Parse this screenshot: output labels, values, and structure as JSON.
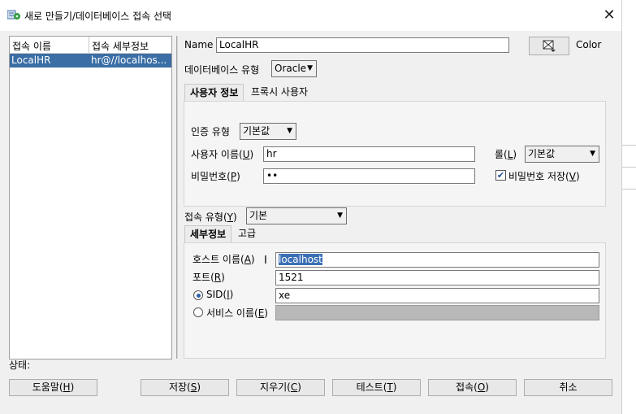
{
  "window": {
    "title": "새로 만들기/데이터베이스 접속 선택",
    "close_glyph": "✕"
  },
  "connections": {
    "columns": [
      "접속 이름",
      "접속 세부정보"
    ],
    "rows": [
      {
        "name": "LocalHR",
        "details": "hr@//localhos..."
      }
    ]
  },
  "form": {
    "name_label": "Name",
    "name_value": "LocalHR",
    "color_label": "Color",
    "dbtype_label": "데이터베이스 유형",
    "dbtype_value": "Oracle",
    "tabs": [
      "사용자 정보",
      "프록시 사용자"
    ],
    "auth_type_label": "인증 유형",
    "auth_type_value": "기본값",
    "username_label": "사용자 이름(",
    "username_key": "U",
    "username_value": "hr",
    "role_label": "롤(",
    "role_key": "L",
    "role_value": "기본값",
    "password_label": "비밀번호(",
    "password_key": "P",
    "password_value": "••",
    "save_password_label": "비밀번호 저장(",
    "save_password_key": "V",
    "save_password_checked": true,
    "conn_type_label": "접속 유형(",
    "conn_type_key": "Y",
    "conn_type_value": "기본",
    "detail_tabs": [
      "세부정보",
      "고급"
    ],
    "host_label": "호스트 이름(",
    "host_key": "A",
    "host_value": "localhost",
    "port_label": "포트(",
    "port_key": "R",
    "port_value": "1521",
    "sid_label": "SID(",
    "sid_key": "I",
    "sid_value": "xe",
    "sid_selected": true,
    "service_label": "서비스 이름(",
    "service_key": "E",
    "service_value": ""
  },
  "status": {
    "label": "상태:"
  },
  "buttons": [
    {
      "pre": "도움말(",
      "key": "H"
    },
    {
      "pre": "저장(",
      "key": "S"
    },
    {
      "pre": "지우기(",
      "key": "C"
    },
    {
      "pre": "테스트(",
      "key": "T"
    },
    {
      "pre": "접속(",
      "key": "O"
    },
    {
      "pre": "취소",
      "key": ""
    }
  ],
  "colors": {
    "selection": "#3a6ea5",
    "host_highlight": "#3b6fb4",
    "disabled_field": "#b8b8b8"
  }
}
